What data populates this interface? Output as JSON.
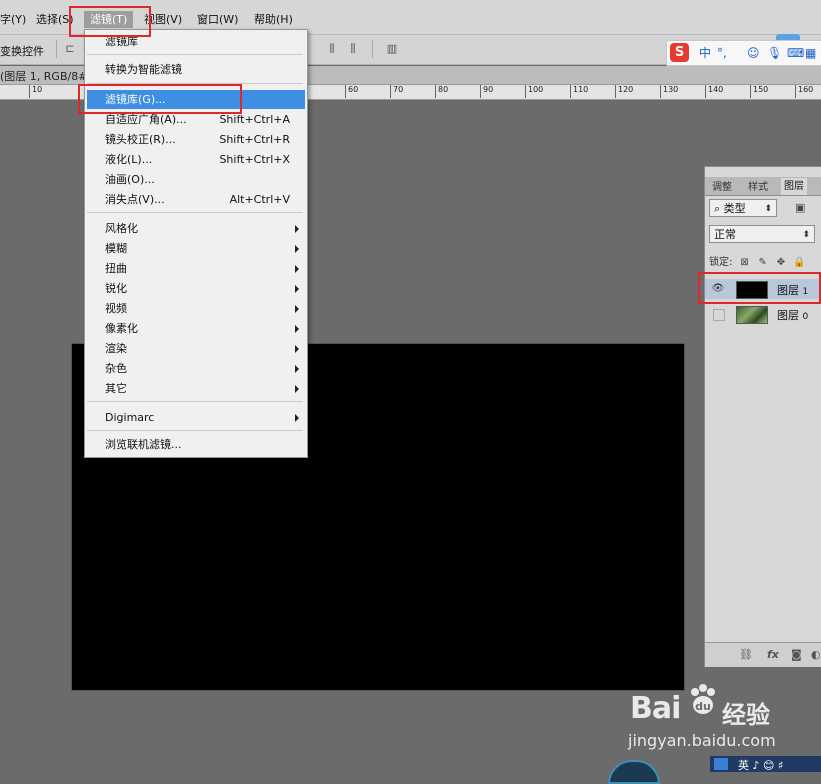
{
  "menubar": {
    "items": [
      {
        "label": "字(Y)"
      },
      {
        "label": "选择(S)"
      },
      {
        "label": "滤镜(T)"
      },
      {
        "label": "视图(V)"
      },
      {
        "label": "窗口(W)"
      },
      {
        "label": "帮助(H)"
      }
    ]
  },
  "optionsbar": {
    "label": "变换控件"
  },
  "doctab": {
    "title": "(图层 1, RGB/8#"
  },
  "ruler": {
    "ticks": [
      "10",
      "60",
      "70",
      "80",
      "90",
      "100",
      "110",
      "120",
      "130",
      "140",
      "150",
      "160"
    ]
  },
  "dropdown": {
    "items": [
      {
        "label": "滤镜库",
        "shortcut": "",
        "submenu": false
      },
      {
        "label": "转换为智能滤镜",
        "shortcut": "",
        "submenu": false
      },
      {
        "label": "滤镜库(G)...",
        "shortcut": "",
        "submenu": false,
        "highlighted": true
      },
      {
        "label": "自适应广角(A)...",
        "shortcut": "Shift+Ctrl+A",
        "submenu": false
      },
      {
        "label": "镜头校正(R)...",
        "shortcut": "Shift+Ctrl+R",
        "submenu": false
      },
      {
        "label": "液化(L)...",
        "shortcut": "Shift+Ctrl+X",
        "submenu": false
      },
      {
        "label": "油画(O)...",
        "shortcut": "",
        "submenu": false
      },
      {
        "label": "消失点(V)...",
        "shortcut": "Alt+Ctrl+V",
        "submenu": false
      },
      {
        "label": "风格化",
        "shortcut": "",
        "submenu": true
      },
      {
        "label": "模糊",
        "shortcut": "",
        "submenu": true
      },
      {
        "label": "扭曲",
        "shortcut": "",
        "submenu": true
      },
      {
        "label": "锐化",
        "shortcut": "",
        "submenu": true
      },
      {
        "label": "视频",
        "shortcut": "",
        "submenu": true
      },
      {
        "label": "像素化",
        "shortcut": "",
        "submenu": true
      },
      {
        "label": "渲染",
        "shortcut": "",
        "submenu": true
      },
      {
        "label": "杂色",
        "shortcut": "",
        "submenu": true
      },
      {
        "label": "其它",
        "shortcut": "",
        "submenu": true
      },
      {
        "label": "Digimarc",
        "shortcut": "",
        "submenu": true
      },
      {
        "label": "浏览联机滤镜...",
        "shortcut": "",
        "submenu": false
      }
    ]
  },
  "layers_panel": {
    "tabs": [
      "调整",
      "样式",
      "图层"
    ],
    "filter_kind": "类型",
    "blend_mode": "正常",
    "lock_label": "锁定:",
    "layers": [
      {
        "name": "图层",
        "index": "1",
        "visible": true,
        "selected": true,
        "thumb_color": "#000000"
      },
      {
        "name": "图层",
        "index": "0",
        "visible": false,
        "selected": false,
        "thumb_color": "#5a7a3a"
      }
    ],
    "footer_fx": "fx"
  },
  "ime": {
    "logo": "S",
    "mode": "中",
    "punct": "°,"
  },
  "watermark": {
    "brand": "Bai",
    "brand2": "du",
    "cn": "经验",
    "url": "jingyan.baidu.com"
  },
  "taskbar": {
    "text": "英 ♪ 😊 ♯"
  },
  "colors": {
    "highlight": "#3e8fe3",
    "annotation_red": "#e0282c",
    "canvas": "#000000",
    "workspace": "#6b6b6b"
  }
}
